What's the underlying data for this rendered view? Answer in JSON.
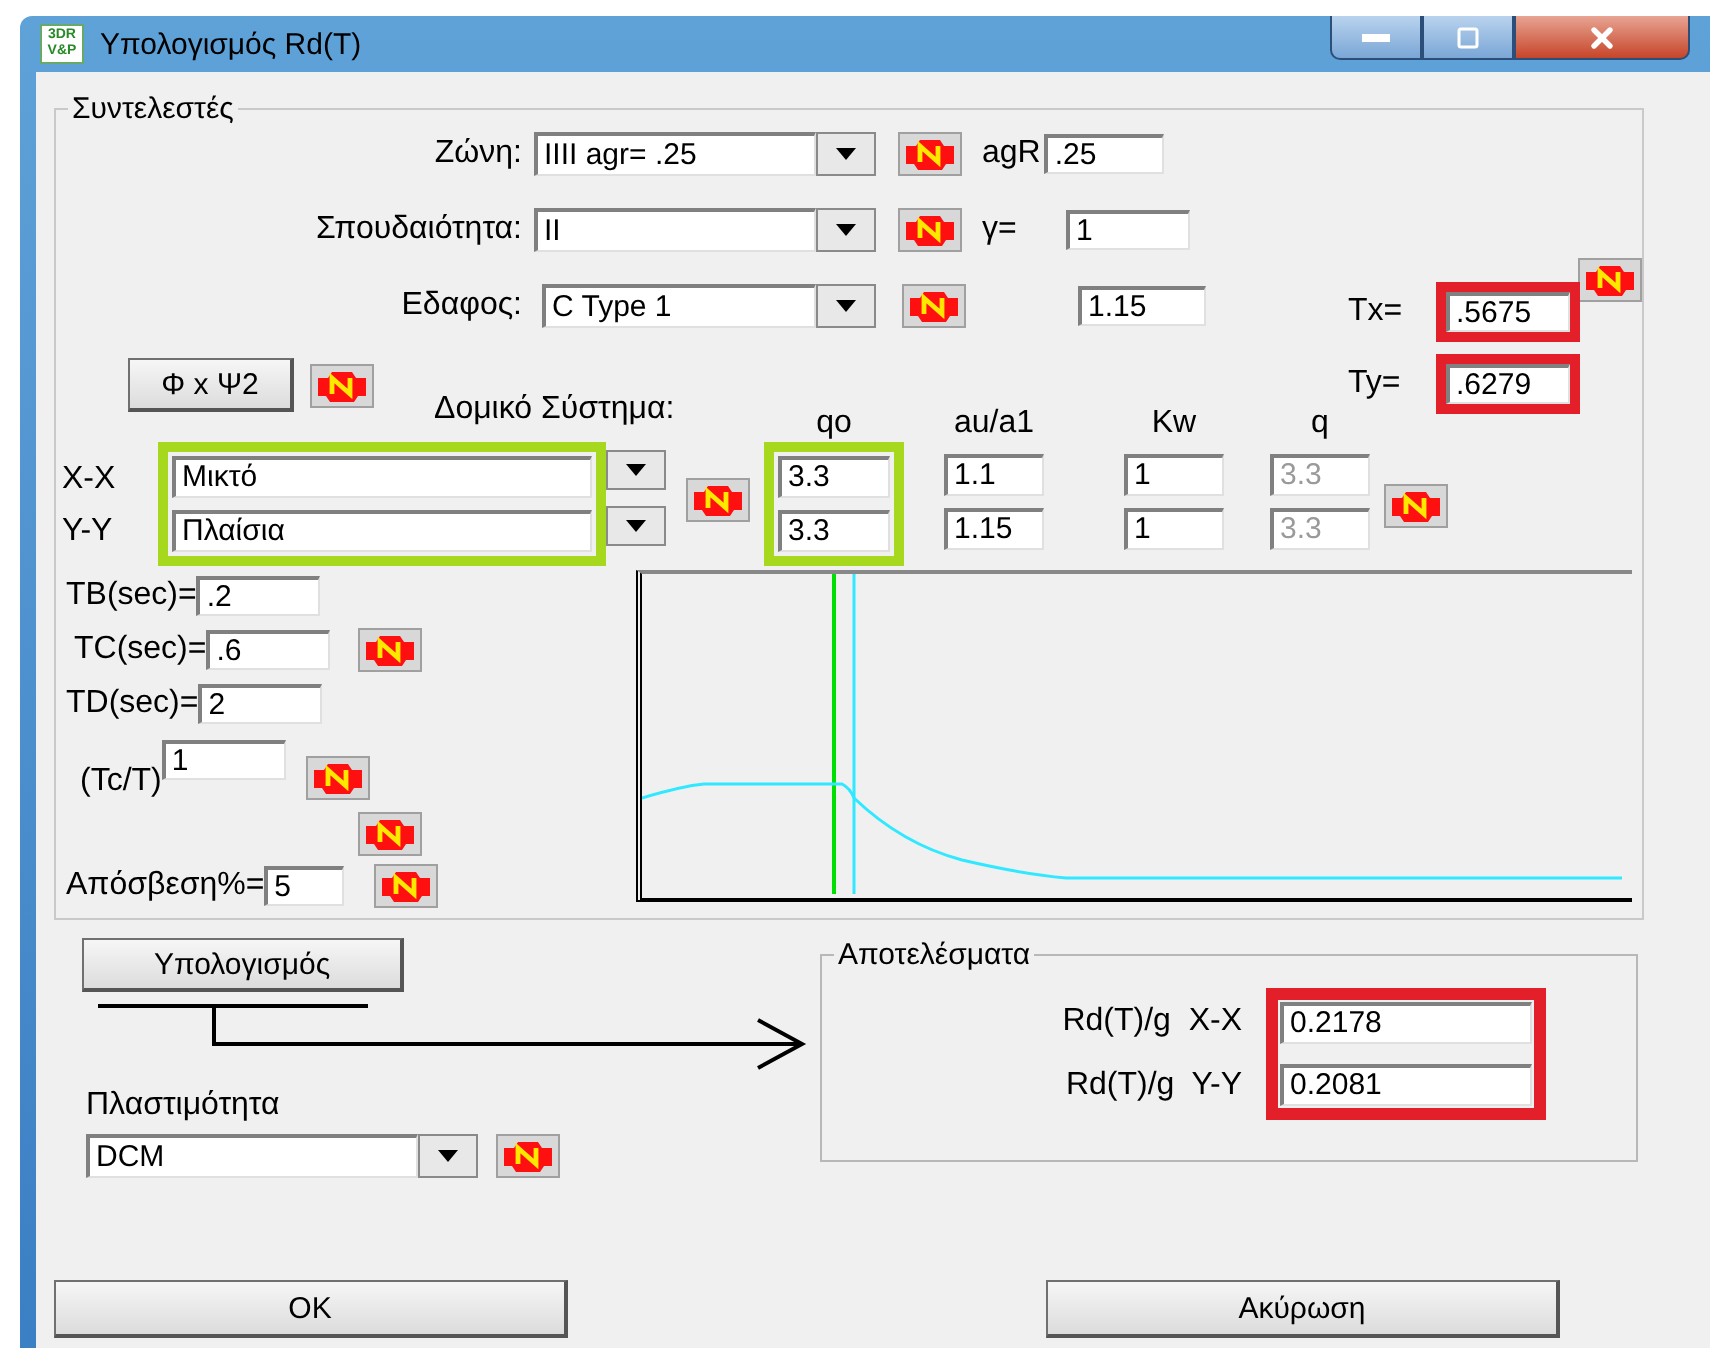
{
  "window": {
    "title": "Υπολογισμός Rd(T)",
    "logo": [
      "3DR",
      "V&P"
    ]
  },
  "coefficients": {
    "title": "Συντελεστές",
    "zone": {
      "label": "Ζώνη:",
      "value": "IIII agr= .25"
    },
    "agr": {
      "label": "agR",
      "value": ".25"
    },
    "importance": {
      "label": "Σπουδαιότητα:",
      "value": "II"
    },
    "gamma": {
      "label": "γ=",
      "value": "1"
    },
    "soil": {
      "label": "Εδαφος:",
      "value": "C Type 1"
    },
    "soil_factor": {
      "value": "1.15"
    },
    "tx": {
      "label": "Tx=",
      "value": ".5675"
    },
    "ty": {
      "label": "Ty=",
      "value": ".6279"
    },
    "phi_button": "Φ x Ψ2",
    "system_label": "Δομικό Σύστημα:",
    "columns": [
      "qo",
      "au/a1",
      "Kw",
      "q"
    ],
    "directions": [
      {
        "label": "X-X",
        "system": "Μικτό",
        "qo": "3.3",
        "au_a1": "1.1",
        "kw": "1",
        "q": "3.3",
        "q_disabled": true
      },
      {
        "label": "Y-Y",
        "system": "Πλαίσια",
        "qo": "3.3",
        "au_a1": "1.15",
        "kw": "1",
        "q": "3.3",
        "q_disabled": true
      }
    ],
    "periods": [
      {
        "label": "TB(sec)=",
        "value": ".2"
      },
      {
        "label": "TC(sec)=",
        "value": ".6"
      },
      {
        "label": "TD(sec)=",
        "value": "2"
      }
    ],
    "tc_t": {
      "label": "(Tc/T)",
      "value": "1"
    },
    "damping": {
      "label": "Απόσβεση%=",
      "value": "5"
    }
  },
  "calculate_button": "Υπολογισμός",
  "ductility": {
    "label": "Πλαστιμότητα",
    "value": "DCM"
  },
  "results": {
    "title": "Αποτελέσματα",
    "rows": [
      {
        "label": "Rd(T)/g  X-X",
        "value": "0.2178"
      },
      {
        "label": "Rd(T)/g  Y-Y",
        "value": "0.2081"
      }
    ]
  },
  "buttons": [
    "OK",
    "Ακύρωση"
  ]
}
